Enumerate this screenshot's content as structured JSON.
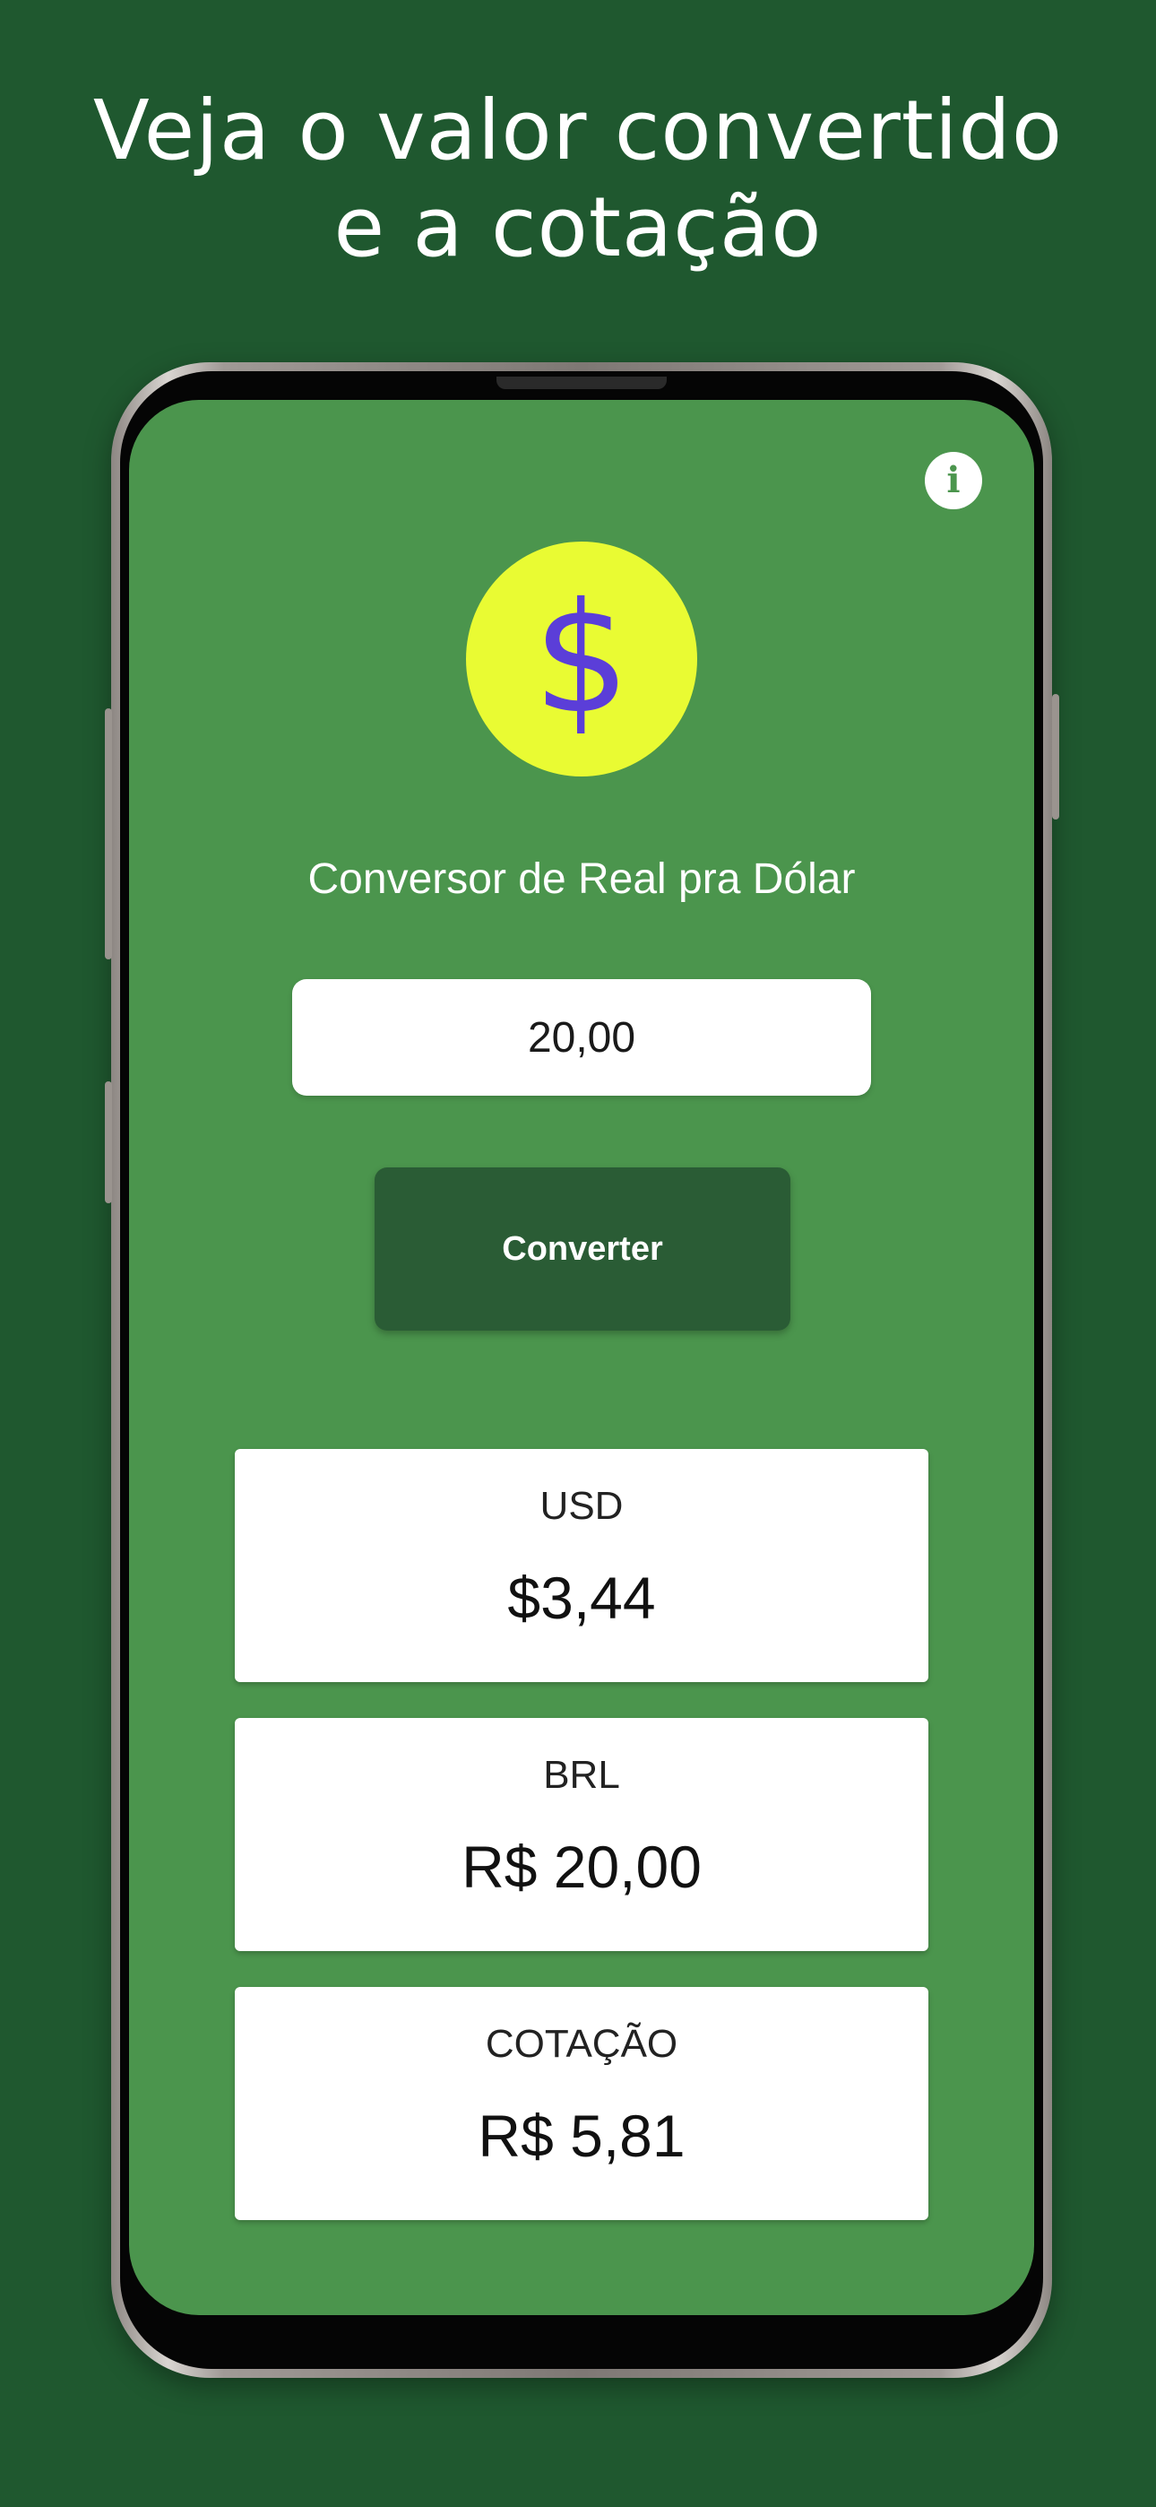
{
  "promo": {
    "headline_line1": "Veja o valor convertido",
    "headline_line2": "e a cotação"
  },
  "app": {
    "info_icon": "i",
    "logo_symbol": "$",
    "title": "Conversor de Real pra Dólar",
    "amount_input_value": "20,00",
    "convert_label": "Converter",
    "results": [
      {
        "label": "USD",
        "value": "$3,44"
      },
      {
        "label": "BRL",
        "value": "R$ 20,00"
      },
      {
        "label": "COTAÇÃO",
        "value": "R$ 5,81"
      }
    ]
  },
  "colors": {
    "page_background": "#1f582f",
    "screen_background": "#4b954d",
    "button_background": "#2a5c35",
    "logo_circle": "#e9fb33",
    "logo_symbol": "#5b3ed8"
  },
  "icons": {
    "info": "info-icon",
    "logo": "dollar-sign-icon"
  }
}
